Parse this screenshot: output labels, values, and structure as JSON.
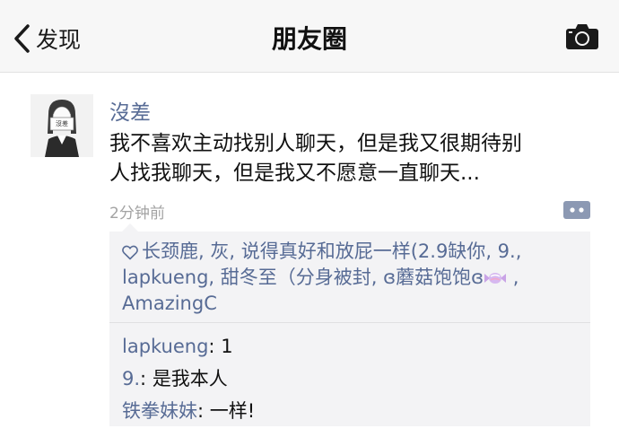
{
  "navbar": {
    "back_label": "发现",
    "title": "朋友圈",
    "icons": {
      "back": "chevron-left-icon",
      "camera": "camera-icon"
    }
  },
  "post": {
    "author": "沒差",
    "avatar_tag": "沒差",
    "text_line1": "我不喜欢主动找别人聊天，但是我又很期待别",
    "text_line2": "人找我聊天，但是我又不愿意一直聊天...",
    "time": "2分钟前",
    "more_icon": "comment-more-icon"
  },
  "likes": {
    "icon": "heart-outline-icon",
    "line1": [
      "长颈鹿",
      "灰",
      "说得真好和放屁一样(2.9缺你",
      "9."
    ],
    "line2_a": "lapkueng",
    "line2_b": "甜冬至（分身被封",
    "line2_c": "ɞ蘑菇饱饱ɞ",
    "line3": "AmazingC",
    "sep": ", ",
    "sep_trailing": " ,"
  },
  "comments": [
    {
      "name": "lapkueng",
      "sep": ": ",
      "text": "1"
    },
    {
      "name": "9.",
      "sep": ": ",
      "text": "是我本人"
    },
    {
      "name": "铁拳妹妹",
      "sep": ": ",
      "text": "一样!"
    }
  ],
  "colors": {
    "link": "#576b95",
    "time": "#a3a3a3",
    "navbar_bg": "#f7f7f7",
    "comment_bg": "#f3f3f5"
  }
}
